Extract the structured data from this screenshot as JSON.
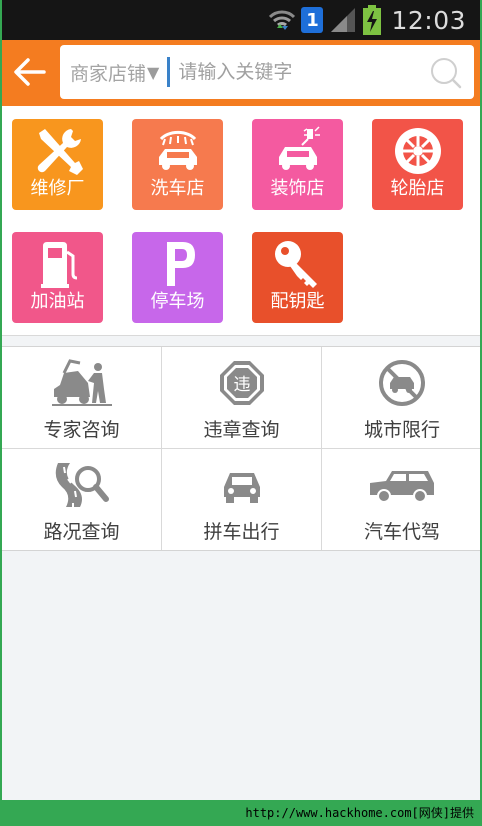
{
  "status_bar": {
    "notification_count": "1",
    "time": "12:03"
  },
  "header": {
    "search_category": "商家店铺",
    "search_placeholder": "请输入关键字"
  },
  "shop_categories": [
    {
      "label": "维修厂",
      "icon": "wrench-screwdriver-icon",
      "color": "#f8961e"
    },
    {
      "label": "洗车店",
      "icon": "car-wash-icon",
      "color": "#f67a4e"
    },
    {
      "label": "装饰店",
      "icon": "car-spray-icon",
      "color": "#f45aa0"
    },
    {
      "label": "轮胎店",
      "icon": "tire-icon",
      "color": "#f25448"
    },
    {
      "label": "加油站",
      "icon": "gas-station-icon",
      "color": "#f1578a"
    },
    {
      "label": "停车场",
      "icon": "parking-icon",
      "color": "#c767ea"
    },
    {
      "label": "配钥匙",
      "icon": "key-icon",
      "color": "#e8502b"
    }
  ],
  "services": [
    {
      "label": "专家咨询",
      "icon": "mechanic-icon"
    },
    {
      "label": "违章查询",
      "icon": "violation-sign-icon",
      "sign_text": "违"
    },
    {
      "label": "城市限行",
      "icon": "no-car-sign-icon"
    },
    {
      "label": "路况查询",
      "icon": "road-search-icon"
    },
    {
      "label": "拼车出行",
      "icon": "carpool-icon"
    },
    {
      "label": "汽车代驾",
      "icon": "suv-icon"
    }
  ],
  "watermark": "http://www.hackhome.com[网侠]提供"
}
